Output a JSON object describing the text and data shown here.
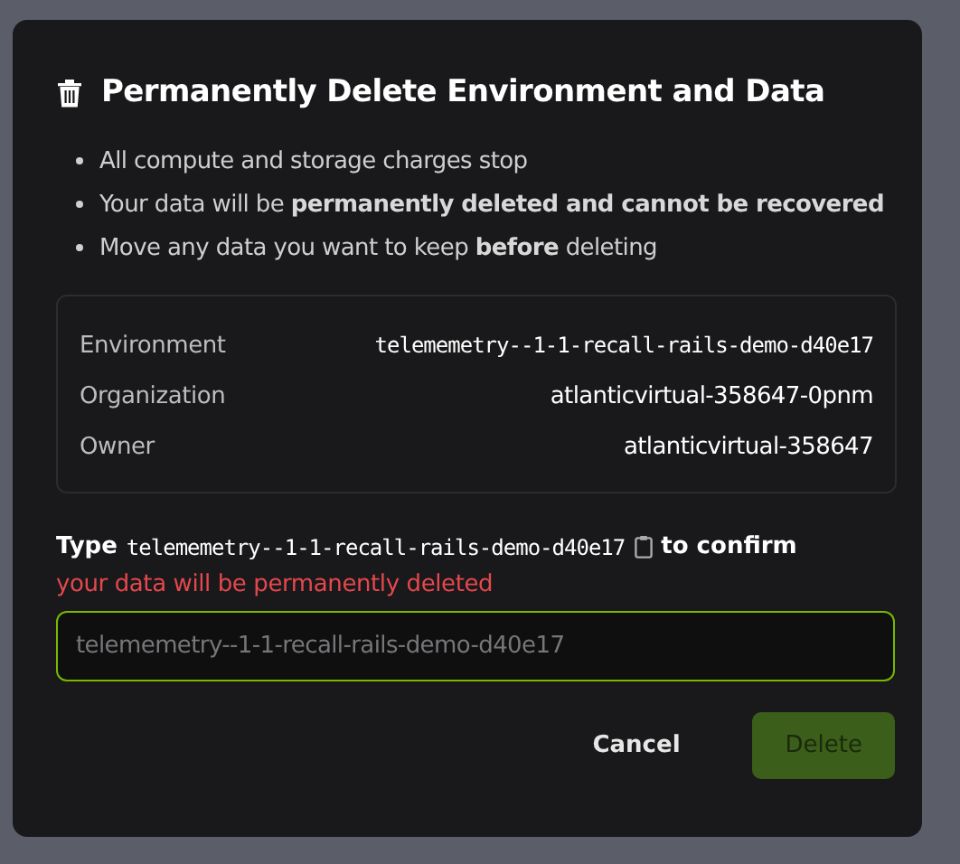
{
  "dialog": {
    "title": "Permanently Delete Environment and Data",
    "bullets": [
      "All compute and storage charges stop",
      "Your data will be **permanently deleted and cannot be recovered**",
      "Move any data you want to keep **before** deleting"
    ],
    "details": [
      {
        "label": "Environment",
        "value": "telememetry--1-1-recall-rails-demo-d40e17",
        "kind": "mono"
      },
      {
        "label": "Organization",
        "value": "atlanticvirtual-358647-0pnm",
        "kind": "plain"
      },
      {
        "label": "Owner",
        "value": "atlanticvirtual-358647",
        "kind": "plain"
      }
    ],
    "confirm": {
      "prefix": "Type",
      "name": "telememetry--1-1-recall-rails-demo-d40e17",
      "suffix": "to confirm"
    },
    "error": "your data will be permanently deleted",
    "input": {
      "placeholder": "telememetry--1-1-recall-rails-demo-d40e17",
      "focused": true
    },
    "buttons": [
      {
        "label": "Cancel",
        "kind": "secondary",
        "disabled": false
      },
      {
        "label": "Delete",
        "kind": "primary",
        "disabled": true
      }
    ]
  }
}
